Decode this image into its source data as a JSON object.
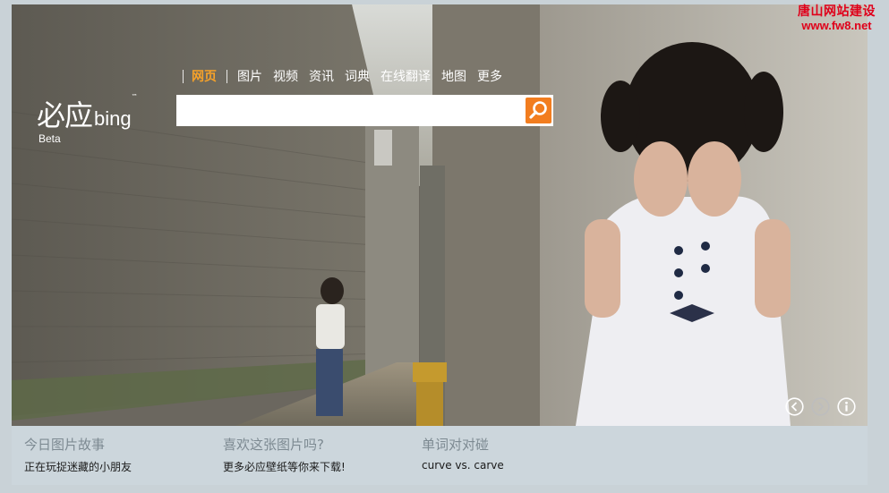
{
  "watermark": {
    "line1": "唐山网站建设",
    "line2": "www.fw8.net"
  },
  "logo": {
    "cn": "必应",
    "en": "bing",
    "tm": "™",
    "beta": "Beta"
  },
  "nav": {
    "items": [
      "网页",
      "图片",
      "视频",
      "资讯",
      "词典",
      "在线翻译",
      "地图",
      "更多"
    ],
    "active_index": 0
  },
  "search": {
    "value": "",
    "placeholder": "",
    "button_icon": "search-icon"
  },
  "controls": {
    "icons": [
      "chevron-left-icon",
      "chevron-right-icon",
      "info-icon"
    ]
  },
  "bottom": {
    "col1": {
      "heading": "今日图片故事",
      "link": "正在玩捉迷藏的小朋友"
    },
    "col2": {
      "heading": "喜欢这张图片吗?",
      "link": "更多必应壁纸等你来下载!"
    },
    "col3": {
      "heading": "单词对对碰",
      "link": "curve vs. carve"
    }
  },
  "colors": {
    "accent": "#f27d1f",
    "nav_active": "#f7a229",
    "bar": "#ccd6dc"
  }
}
